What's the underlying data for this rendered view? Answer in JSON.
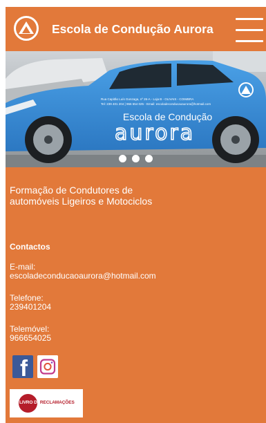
{
  "header": {
    "title": "Escola de Condução Aurora"
  },
  "hero": {
    "car_brand_text": "Escola de Condução",
    "car_brand_big": "aurora",
    "car_address_line1": "Rua Capitão Luís Gonzaga, nº 26-A - Loja B - OLIVAIS - COIMBRA",
    "car_address_line2": "Tel: 239 401 204 | 966 654 025 - Email: escoladeconducaoaurora@hotmail.com",
    "slides_count": 3
  },
  "main": {
    "tagline": "Formação de Condutores de automóveis Ligeiros e Motociclos",
    "contacts_title": "Contactos",
    "email_label": "E-mail:",
    "email_value": "escoladeconducaoaurora@hotmail.com",
    "phone_label": "Telefone:",
    "phone_value": "239401204",
    "mobile_label": "Telemóvel:",
    "mobile_value": "966654025"
  },
  "social": {
    "facebook_glyph": "f",
    "facebook_icon": "facebook-icon",
    "instagram_icon": "instagram-icon"
  },
  "complaints": {
    "label_part1": "LIVRO DE",
    "label_part2": "RECLAMAÇÕES"
  },
  "colors": {
    "primary": "#e2793a",
    "facebook": "#3b5998",
    "car_blue": "#3a8fd6"
  }
}
